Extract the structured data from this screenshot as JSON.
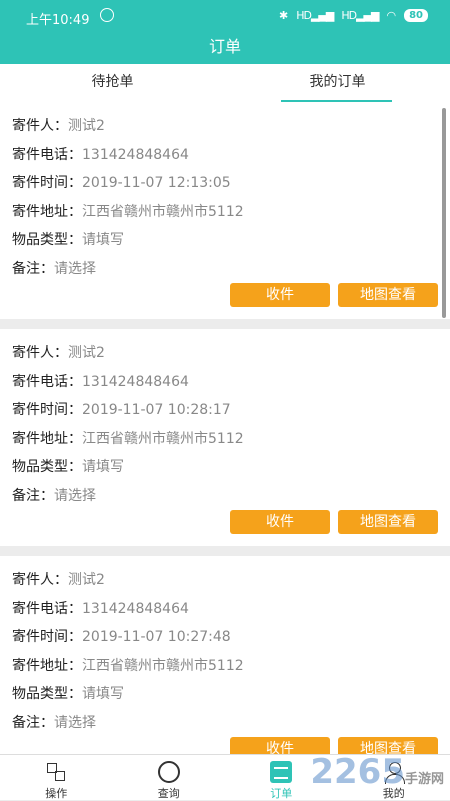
{
  "status": {
    "time": "上午10:49",
    "network": "HD",
    "battery": "80"
  },
  "header": {
    "title": "订单"
  },
  "tabs": [
    {
      "label": "待抢单"
    },
    {
      "label": "我的订单"
    }
  ],
  "labels": {
    "sender": "寄件人：",
    "phone": "寄件电话：",
    "time": "寄件时间：",
    "address": "寄件地址：",
    "type": "物品类型：",
    "note": "备注：",
    "receive": "收件",
    "map": "地图查看"
  },
  "orders": [
    {
      "sender": "测试2",
      "phone": "131424848464",
      "time": "2019-11-07 12:13:05",
      "address": "江西省赣州市赣州市5112",
      "type": "请填写",
      "note": "请选择"
    },
    {
      "sender": "测试2",
      "phone": "131424848464",
      "time": "2019-11-07 10:28:17",
      "address": "江西省赣州市赣州市5112",
      "type": "请填写",
      "note": "请选择"
    },
    {
      "sender": "测试2",
      "phone": "131424848464",
      "time": "2019-11-07 10:27:48",
      "address": "江西省赣州市赣州市5112",
      "type": "请填写",
      "note": "请选择"
    }
  ],
  "nav": [
    {
      "label": "操作"
    },
    {
      "label": "查询"
    },
    {
      "label": "订单"
    },
    {
      "label": "我的"
    }
  ],
  "watermark": {
    "number": "2265",
    "text": "手游网"
  },
  "colors": {
    "primary": "#2ec3b6",
    "button": "#f5a21b"
  }
}
